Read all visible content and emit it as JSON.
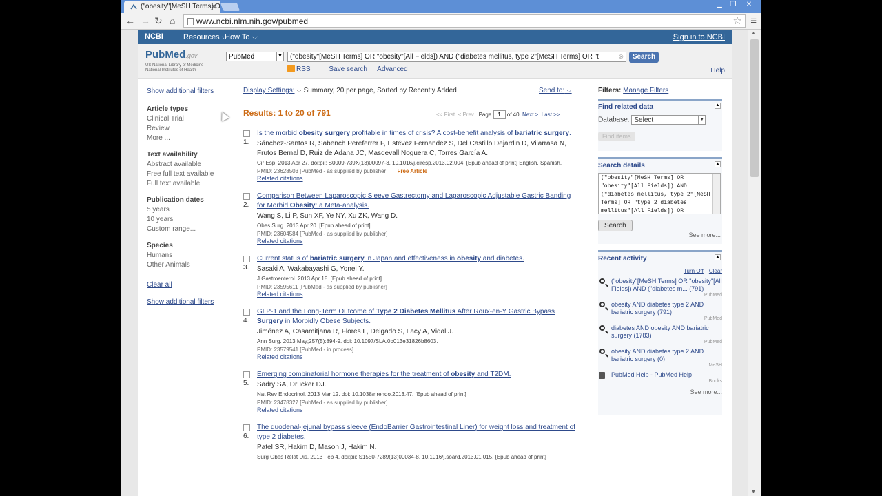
{
  "browser": {
    "tab_title": "(\"obesity\"[MeSH Terms] O",
    "url": "www.ncbi.nlm.nih.gov/pubmed"
  },
  "ncbi": {
    "logo": "NCBI",
    "resources": "Resources",
    "howto": "How To",
    "signin": "Sign in to NCBI"
  },
  "header": {
    "logo_pub": "PubMed",
    "logo_gov": ".gov",
    "logo_sub1": "US National Library of Medicine",
    "logo_sub2": "National Institutes of Health",
    "db": "PubMed",
    "query": "(\"obesity\"[MeSH Terms] OR \"obesity\"[All Fields]) AND (\"diabetes mellitus, type 2\"[MeSH Terms] OR \"t",
    "search_button": "Search",
    "rss": "RSS",
    "save_search": "Save search",
    "advanced": "Advanced",
    "help": "Help"
  },
  "left": {
    "show_filters_top": "Show additional filters",
    "groups": [
      {
        "title": "Article types",
        "items": [
          "Clinical Trial",
          "Review",
          "More ..."
        ]
      },
      {
        "title": "Text availability",
        "items": [
          "Abstract available",
          "Free full text available",
          "Full text available"
        ]
      },
      {
        "title": "Publication dates",
        "items": [
          "5 years",
          "10 years",
          "Custom range..."
        ]
      },
      {
        "title": "Species",
        "items": [
          "Humans",
          "Other Animals"
        ]
      }
    ],
    "clear_all": "Clear all",
    "show_filters_bottom": "Show additional filters"
  },
  "main": {
    "display_settings_label": "Display Settings:",
    "display_settings_value": "Summary, 20 per page, Sorted by Recently Added",
    "send_to": "Send to:",
    "results": "Results: 1 to 20 of 791",
    "pager": {
      "first": "<< First",
      "prev": "< Prev",
      "page_label": "Page",
      "page": "1",
      "of": "of 40",
      "next": "Next >",
      "last": "Last >>"
    },
    "items": [
      {
        "num": "1.",
        "title": "Is the morbid obesity surgery profitable in times of crisis? A cost-benefit analysis of bariatric surgery.",
        "authors": "Sánchez-Santos R, Sabench Pereferrer F, Estévez Fernandez S, Del Castillo Dejardin D, Vilarrasa N, Frutos Bernal D, Ruiz de Adana JC, Masdevall Noguera C, Torres García A.",
        "journal": "Cir Esp. 2013 Apr 27. doi:pii: S0009-739X(13)00097-3. 10.1016/j.ciresp.2013.02.004. [Epub ahead of print] English, Spanish.",
        "pmid": "PMID: 23628503 [PubMed - as supplied by publisher]",
        "free": "Free Article",
        "related": "Related citations"
      },
      {
        "num": "2.",
        "title": "Comparison Between Laparoscopic Sleeve Gastrectomy and Laparoscopic Adjustable Gastric Banding for Morbid Obesity: a Meta-analysis.",
        "authors": "Wang S, Li P, Sun XF, Ye NY, Xu ZK, Wang D.",
        "journal": "Obes Surg. 2013 Apr 20. [Epub ahead of print]",
        "pmid": "PMID: 23604584 [PubMed - as supplied by publisher]",
        "free": "",
        "related": "Related citations"
      },
      {
        "num": "3.",
        "title": "Current status of bariatric surgery in Japan and effectiveness in obesity and diabetes.",
        "authors": "Sasaki A, Wakabayashi G, Yonei Y.",
        "journal": "J Gastroenterol. 2013 Apr 18. [Epub ahead of print]",
        "pmid": "PMID: 23595611 [PubMed - as supplied by publisher]",
        "free": "",
        "related": "Related citations"
      },
      {
        "num": "4.",
        "title": "GLP-1 and the Long-Term Outcome of Type 2 Diabetes Mellitus After Roux-en-Y Gastric Bypass Surgery in Morbidly Obese Subjects.",
        "authors": "Jiménez A, Casamitjana R, Flores L, Delgado S, Lacy A, Vidal J.",
        "journal": "Ann Surg. 2013 May;257(5):894-9. doi: 10.1097/SLA.0b013e31826b8603.",
        "pmid": "PMID: 23579541 [PubMed - in process]",
        "free": "",
        "related": "Related citations"
      },
      {
        "num": "5.",
        "title": "Emerging combinatorial hormone therapies for the treatment of obesity and T2DM.",
        "authors": "Sadry SA, Drucker DJ.",
        "journal": "Nat Rev Endocrinol. 2013 Mar 12. doi: 10.1038/nrendo.2013.47. [Epub ahead of print]",
        "pmid": "PMID: 23478327 [PubMed - as supplied by publisher]",
        "free": "",
        "related": "Related citations"
      },
      {
        "num": "6.",
        "title": "The duodenal-jejunal bypass sleeve (EndoBarrier Gastrointestinal Liner) for weight loss and treatment of type 2 diabetes.",
        "authors": "Patel SR, Hakim D, Mason J, Hakim N.",
        "journal": "Surg Obes Relat Dis. 2013 Feb 4. doi:pii: S1550-7289(13)00034-8. 10.1016/j.soard.2013.01.015. [Epub ahead of print]",
        "pmid": "",
        "free": "",
        "related": ""
      }
    ]
  },
  "right": {
    "filters_label": "Filters:",
    "manage_filters": "Manage Filters",
    "related_title": "Find related data",
    "database_label": "Database:",
    "database_value": "Select",
    "find_items": "Find items",
    "details_title": "Search details",
    "details_text": "(\"obesity\"[MeSH Terms] OR \"obesity\"[All Fields]) AND (\"diabetes mellitus, type 2\"[MeSH Terms] OR \"type 2 diabetes mellitus\"[All Fields]) OR",
    "details_search": "Search",
    "see_more_1": "See more...",
    "recent_title": "Recent activity",
    "turn_off": "Turn Off",
    "clear": "Clear",
    "recent": [
      {
        "q": "(\"obesity\"[MeSH Terms] OR \"obesity\"[All Fields]) AND (\"diabetes m... (791)",
        "db": "PubMed",
        "icon": "search-icon"
      },
      {
        "q": "obesity AND diabetes type 2 AND bariatric surgery (791)",
        "db": "PubMed",
        "icon": "search-icon"
      },
      {
        "q": "diabetes AND obesity AND bariatric surgery (1783)",
        "db": "PubMed",
        "icon": "search-icon"
      },
      {
        "q": "obesity AND diabetes type 2 AND bariatric surgery (0)",
        "db": "MeSH",
        "icon": "search-icon"
      },
      {
        "q": "PubMed Help - PubMed Help",
        "db": "Books",
        "icon": "book-icon"
      }
    ],
    "see_more_2": "See more..."
  }
}
